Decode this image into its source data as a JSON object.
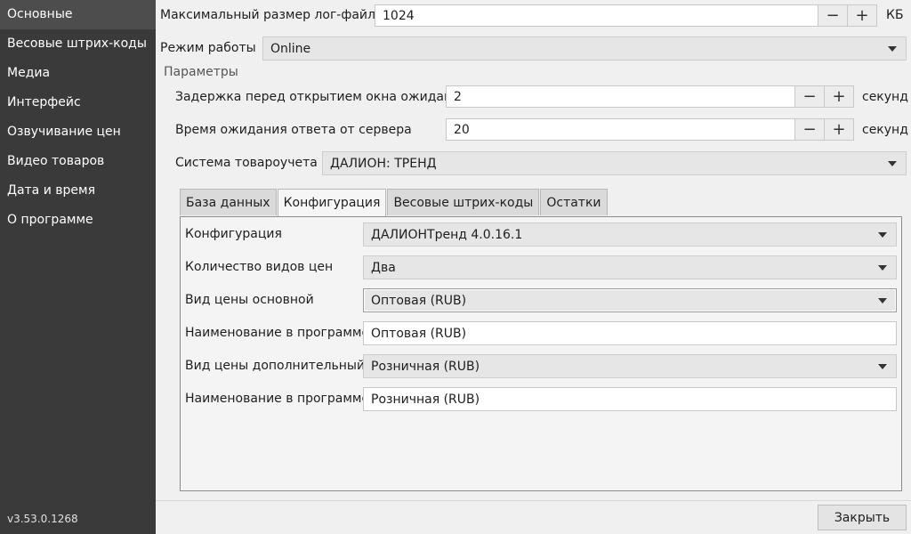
{
  "sidebar": {
    "items": [
      {
        "label": "Основные"
      },
      {
        "label": "Весовые штрих-коды"
      },
      {
        "label": "Медиа"
      },
      {
        "label": "Интерфейс"
      },
      {
        "label": "Озвучивание цен"
      },
      {
        "label": "Видео товаров"
      },
      {
        "label": "Дата и время"
      },
      {
        "label": "О программе"
      }
    ],
    "version": "v3.53.0.1268"
  },
  "general": {
    "max_log_label": "Максимальный размер лог-файла",
    "max_log_value": "1024",
    "max_log_unit": "КБ",
    "mode_label": "Режим работы",
    "mode_value": "Online",
    "params_title": "Параметры",
    "delay_label": "Задержка перед открытием окна ожидания",
    "delay_value": "2",
    "delay_unit": "секунд",
    "timeout_label": "Время ожидания ответа от сервера",
    "timeout_value": "20",
    "timeout_unit": "секунд",
    "system_label": "Система товароучета",
    "system_value": "ДАЛИОН: ТРЕНД",
    "minus": "−",
    "plus": "+"
  },
  "tabs": [
    {
      "label": "База данных"
    },
    {
      "label": "Конфигурация"
    },
    {
      "label": "Весовые штрих-коды"
    },
    {
      "label": "Остатки"
    }
  ],
  "config": {
    "configuration_label": "Конфигурация",
    "configuration_value": "ДАЛИОНТренд 4.0.16.1",
    "price_count_label": "Количество видов цен",
    "price_count_value": "Два",
    "main_price_label": "Вид цены основной",
    "main_price_value": "Оптовая (RUB)",
    "main_name_label": "Наименование в программе",
    "main_name_value": "Оптовая (RUB)",
    "extra_price_label": "Вид цены дополнительный",
    "extra_price_value": "Розничная (RUB)",
    "extra_name_label": "Наименование в программе",
    "extra_name_value": "Розничная (RUB)"
  },
  "footer": {
    "close_label": "Закрыть"
  }
}
